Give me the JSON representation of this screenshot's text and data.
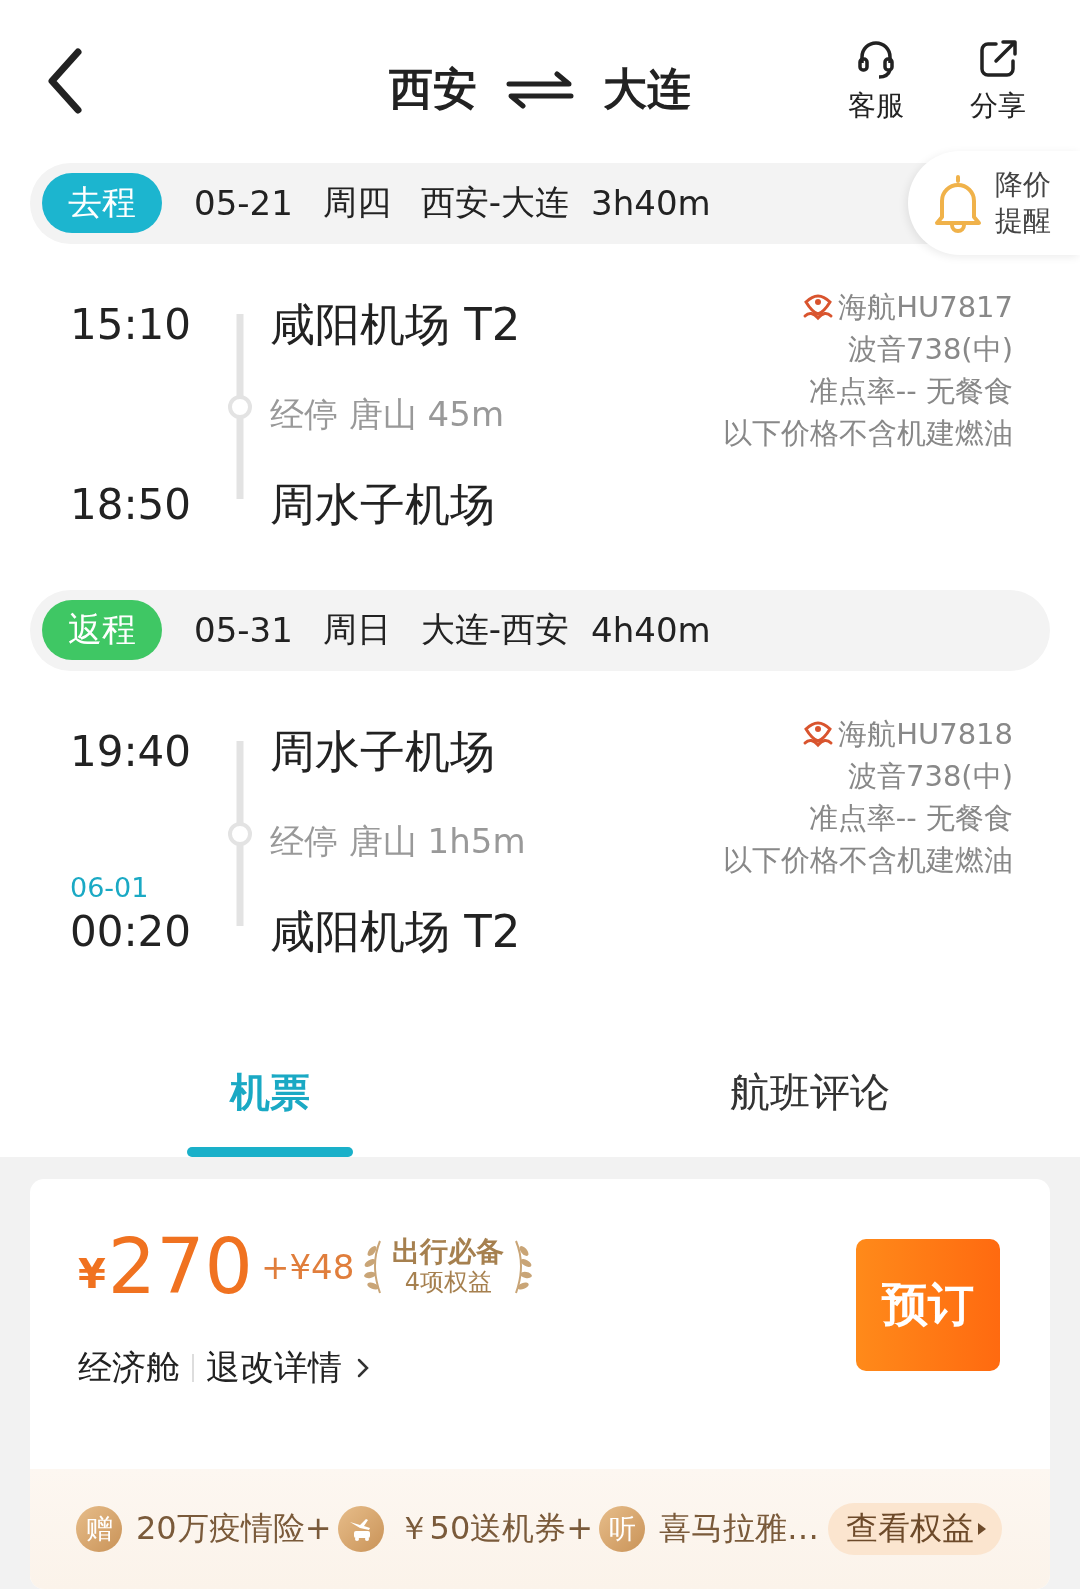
{
  "header": {
    "origin": "西安",
    "destination": "大连",
    "actions": [
      {
        "kind": "service",
        "label": "客服"
      },
      {
        "kind": "share",
        "label": "分享"
      }
    ]
  },
  "legs": [
    {
      "tag": "去程",
      "color": "#1cb5cf",
      "date": "05-21",
      "weekday": "周四",
      "route": "西安-大连",
      "duration": "3h40m",
      "price_alert": "降价提醒",
      "depart_time": "15:10",
      "depart_airport": "咸阳机场 T2",
      "stop": "经停 唐山 45m",
      "arrive_time": "18:50",
      "arrive_airport": "周水子机场",
      "flight": "海航HU7817",
      "aircraft": "波音738(中)",
      "service": "准点率-- 无餐食",
      "note": "以下价格不含机建燃油"
    },
    {
      "tag": "返程",
      "color": "#3fc764",
      "date": "05-31",
      "weekday": "周日",
      "route": "大连-西安",
      "duration": "4h40m",
      "depart_time": "19:40",
      "depart_airport": "周水子机场",
      "stop": "经停 唐山 1h5m",
      "arrive_date": "06-01",
      "arrive_time": "00:20",
      "arrive_airport": "咸阳机场 T2",
      "flight": "海航HU7818",
      "aircraft": "波音738(中)",
      "service": "准点率-- 无餐食",
      "note": "以下价格不含机建燃油"
    }
  ],
  "tabs": [
    {
      "label": "机票",
      "selected": true
    },
    {
      "label": "航班评论",
      "selected": false
    }
  ],
  "fare": {
    "currency": "¥",
    "price": "270",
    "extra": "+¥48",
    "badge_title": "出行必备",
    "badge_subtitle": "4项权益",
    "cabin": "经济舱",
    "rules": "退改详情",
    "book": "预订",
    "perks": [
      {
        "kind": "char",
        "icon": "赠",
        "text": "20万疫情险+"
      },
      {
        "kind": "drawing",
        "text": "￥50送机券+"
      },
      {
        "kind": "char",
        "icon": "听",
        "text": "喜马拉雅…"
      }
    ],
    "more": "查看权益"
  }
}
